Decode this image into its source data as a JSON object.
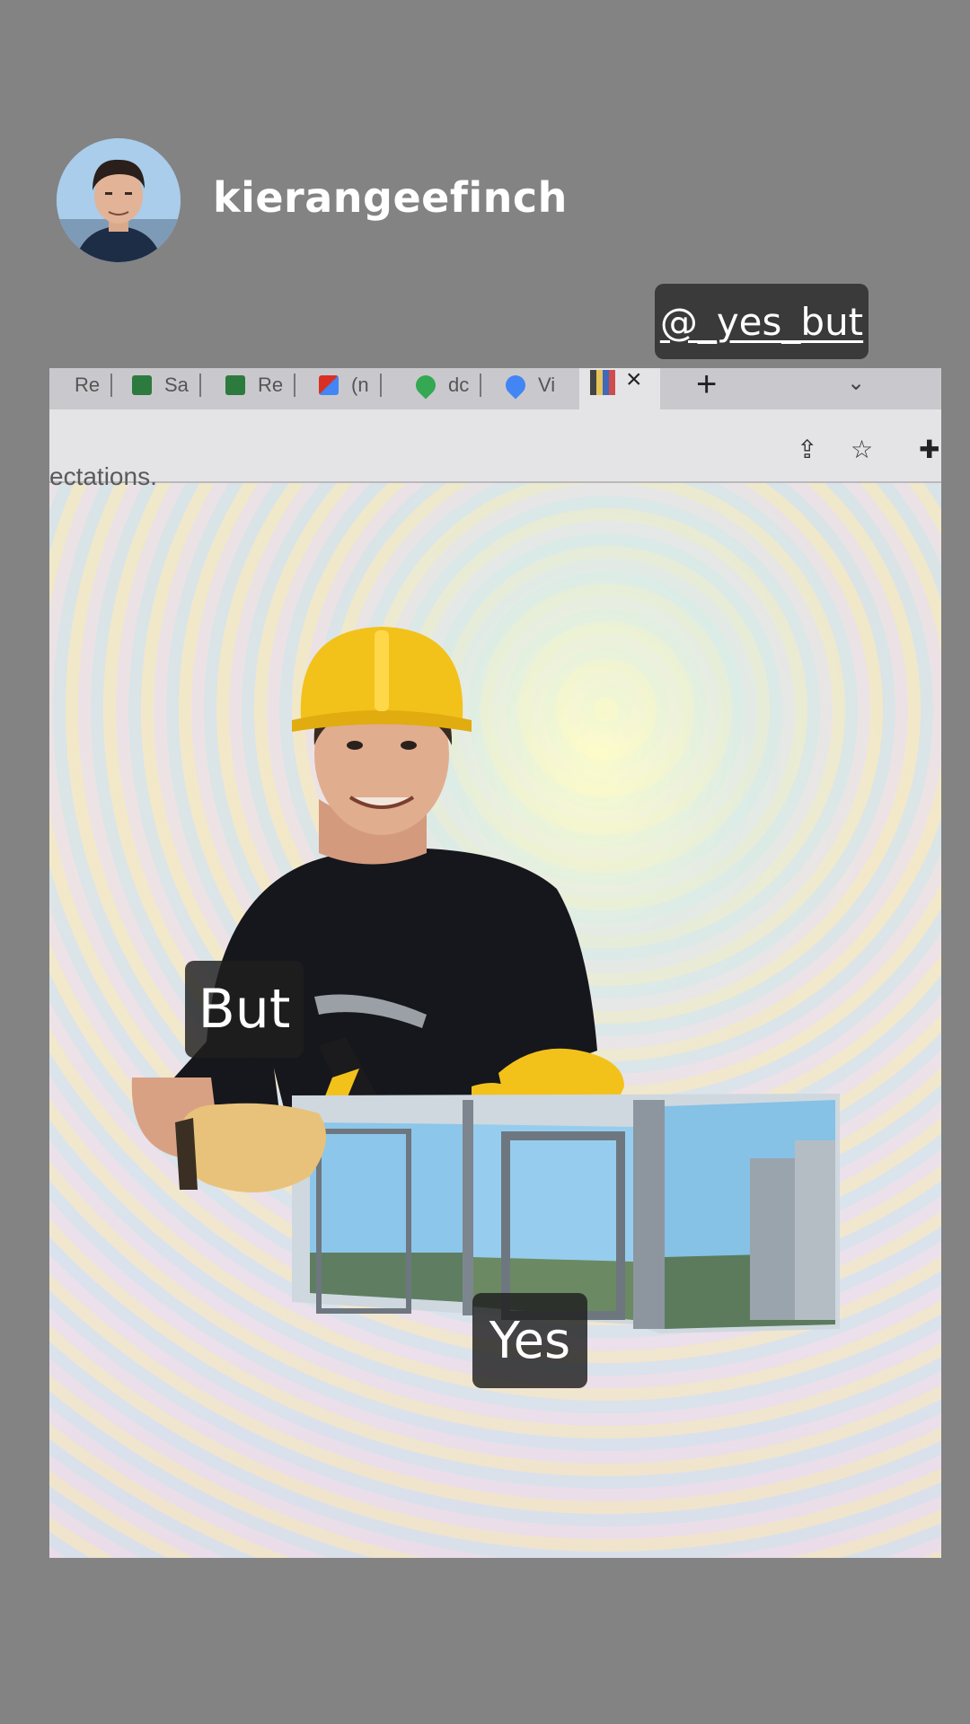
{
  "story": {
    "username": "kierangeefinch",
    "mention": "@_yes_but"
  },
  "photo": {
    "browser_tabs": [
      {
        "label": "Re",
        "icon": "page-icon"
      },
      {
        "label": "Sa",
        "icon": "p-logo-icon"
      },
      {
        "label": "Re",
        "icon": "p-logo-icon"
      },
      {
        "label": "(n",
        "icon": "gmail-icon"
      },
      {
        "label": "dc",
        "icon": "maps-pin-icon"
      },
      {
        "label": "Vi",
        "icon": "maps-pin-icon"
      }
    ],
    "page_text": "ectations.",
    "captions": {
      "but": "But",
      "yes": "Yes"
    }
  },
  "colors": {
    "background": "#838384",
    "caption_bg": "#3a3a3a",
    "hard_hat": "#f2c21b",
    "shirt": "#16171c"
  }
}
